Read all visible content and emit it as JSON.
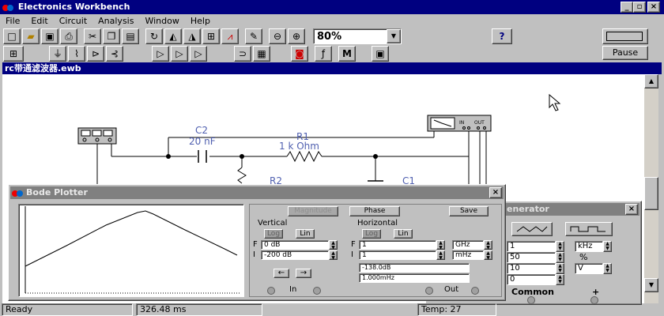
{
  "app": {
    "title": "Electronics Workbench",
    "win_controls": [
      "_",
      "▫",
      "×"
    ]
  },
  "menu": [
    "File",
    "Edit",
    "Circuit",
    "Analysis",
    "Window",
    "Help"
  ],
  "toolbar": {
    "zoom_value": "80%",
    "help_label": "?",
    "pause_label": "Pause",
    "row1_icons": [
      "new-file-icon",
      "open-folder-icon",
      "save-icon",
      "print-icon",
      "cut-icon",
      "copy-icon",
      "paste-icon",
      "rotate-icon",
      "flip-horizontal-icon",
      "flip-vertical-icon",
      "subcircuit-icon",
      "graph-icon",
      "component-properties-icon",
      "zoom-out-icon",
      "zoom-in-icon"
    ],
    "row2_icons": [
      "favorites-icon",
      "sources-icon",
      "basic-icon",
      "diodes-icon",
      "transistors-icon",
      "analog-ic-icon",
      "mixed-ic-icon",
      "digital-ic-icon",
      "logic-gates-icon",
      "digital-icon",
      "indicators-icon",
      "controls-icon",
      "miscellaneous-icon",
      "instruments-icon"
    ],
    "row2_text": {
      "m_label": "M"
    }
  },
  "document": {
    "title": "rc带通滤波器.ewb"
  },
  "circuit": {
    "c2_label": "C2",
    "c2_value": "20 nF",
    "r1_label": "R1",
    "r1_value": "1 k Ohm",
    "r2_label": "R2",
    "c1_label": "C1",
    "bode_in_label": "IN",
    "bode_out_label": "OUT"
  },
  "bode": {
    "title": "Bode Plotter",
    "close_label": "×",
    "magnitude_label": "Magnitude",
    "phase_label": "Phase",
    "save_label": "Save",
    "vertical_label": "Vertical",
    "horizontal_label": "Horizontal",
    "log_label": "Log",
    "lin_label": "Lin",
    "f_label": "F",
    "i_label": "I",
    "v_final": "0 dB",
    "v_initial": "-200 dB",
    "h_final": "1",
    "h_final_unit": "GHz",
    "h_initial": "1",
    "h_initial_unit": "mHz",
    "readout_db": "-138.0dB",
    "readout_freq": "1.000mHz",
    "left_arrow": "←",
    "right_arrow": "→",
    "in_label": "In",
    "out_label": "Out"
  },
  "generator": {
    "title": "enerator",
    "close_label": "×",
    "freq_value": "1",
    "freq_unit": "kHz",
    "duty_value": "50",
    "duty_unit": "%",
    "amp_value": "10",
    "amp_unit": "V",
    "offset_value": "0",
    "common_label": "Common",
    "plus_label": "+"
  },
  "status": {
    "ready": "Ready",
    "time": "326.48 ms",
    "temp": "Temp:  27"
  }
}
